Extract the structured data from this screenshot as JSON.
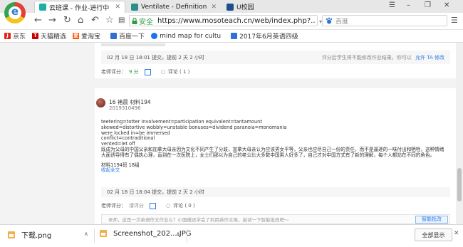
{
  "browser": {
    "tabs": [
      {
        "title": "云班课 - 作业-进行中",
        "favicon_color": "#1ab0a6",
        "active": true
      },
      {
        "title": "Ventilate - Definition for English",
        "favicon_color": "#2a8f86",
        "active": false
      },
      {
        "title": "U校园",
        "favicon_color": "#1f4e8c",
        "active": false
      }
    ],
    "secure_label": "安全",
    "url": "https://www.mosoteach.cn/web/index.php?...",
    "search_placeholder": "百度",
    "bookmarks": [
      {
        "label": "京东",
        "icon_text": "JD",
        "color": "#e1251b"
      },
      {
        "label": "天猫精选",
        "icon_text": "T",
        "color": "#c40000"
      },
      {
        "label": "爱淘宝",
        "icon_text": "爱",
        "color": "#ff5000"
      },
      {
        "label": "百度一下",
        "icon_text": "",
        "color": "#2f6fd6"
      },
      {
        "label": "mind map for cultu",
        "icon_text": "",
        "color": "#1a73e8"
      },
      {
        "label": "2017年6月英语四级",
        "icon_text": "",
        "color": "#2f6fd6"
      }
    ]
  },
  "card1": {
    "submit_time": "02 月 18 日 18:01 提交，提前 2 天 2 小时",
    "hint": "评分后学生将不能修改作业结果，你可以",
    "allow_edit_link": "允许 TA 修改",
    "score_label": "老师评分：",
    "score_value": "9 分",
    "comments": "评论 ( 1 )"
  },
  "card2": {
    "student_name": "16 褚晨 材料194",
    "student_id": "2019310496",
    "lines": [
      "teetering=totter involvement=participation  equivalent=tantamount",
      "skewed=distortive wobbly=unstable bonuses=dividend  paranoia=monomania",
      "were locked in=be immersed",
      "conflict=contraditional",
      "vented=let off",
      "既成为父母的中国父亲和加拿大母亲因为文化不同产生了分歧，加拿大母亲认为应该男女平等，父亲也应尽自己一份的责任，而不是逼递的一味付出和牺牲，这种情绪大面诱导得有了偶执心理，直到在一次医院上，女士们那以为自己的老公比大多数中国男人好多了，自己才对中国方式有了新的理解，每个人都站在不同的角色。"
    ],
    "signature": "材料1194班 18组",
    "collapse_link": "收起全文",
    "submit_time": "02 月 18 日 18:04 提交，提前 2 天 2 小时",
    "score_label": "老师评分：",
    "score_value": "请评分",
    "comments": "评论 ( 0 )",
    "comment_placeholder": "老师，这是一次英语作文作业么？小面模还学会了利用英作文唤，尝试一下智能批改吧～",
    "smart_grade_button": "智能批改"
  },
  "downloads": [
    {
      "name": "下载.png"
    },
    {
      "name": "Screenshot_202....JPG"
    }
  ],
  "show_all_label": "全部显示",
  "colors": {
    "accent": "#1ab0a6",
    "link": "#2a7ae2",
    "green": "#2e9b3f"
  }
}
